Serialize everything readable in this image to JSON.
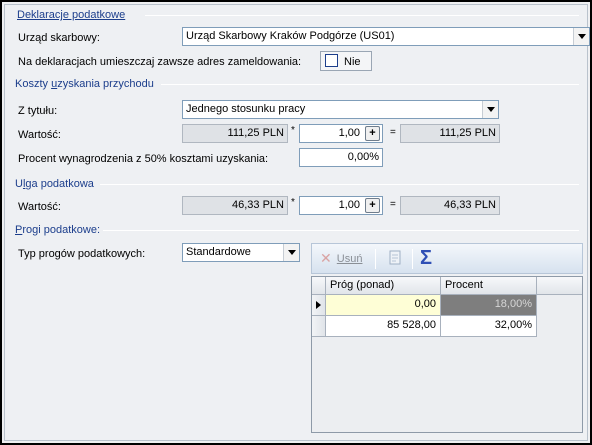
{
  "sections": {
    "declarations": "Deklaracje podatkowe",
    "costs_prefix": "Koszty ",
    "costs_u": "u",
    "costs_suffix": "zyskania przychodu",
    "relief_prefix": "U",
    "relief_u": "l",
    "relief_suffix": "ga podatkowa",
    "thresholds_prefix": "",
    "thresholds_u": "P",
    "thresholds_suffix": "rogi podatkowe:"
  },
  "declarations": {
    "tax_office_label": "Urząd skarbowy:",
    "tax_office_value": "Urząd Skarbowy Kraków Podgórze (US01)",
    "address_label": "Na deklaracjach umieszczaj zawsze adres zameldowania:",
    "address_checkbox_label": "Nie"
  },
  "costs": {
    "title_label": "Z tytułu:",
    "title_value": "Jednego stosunku pracy",
    "value_label": "Wartość:",
    "base_value": "111,25 PLN",
    "multiply_op": "*",
    "multiplier": "1,00",
    "equals_op": "=",
    "result": "111,25 PLN",
    "spin_symbol": "+",
    "percent_label": "Procent wynagrodzenia z 50% kosztami uzyskania:",
    "percent_value": "0,00%"
  },
  "relief": {
    "value_label": "Wartość:",
    "base_value": "46,33 PLN",
    "multiply_op": "*",
    "multiplier": "1,00",
    "equals_op": "=",
    "result": "46,33 PLN",
    "spin_symbol": "+"
  },
  "thresholds": {
    "type_label": "Typ progów podatkowych:",
    "type_value": "Standardowe",
    "toolbar": {
      "delete_label": "Usuń",
      "sum_symbol": "Σ"
    },
    "grid": {
      "columns": [
        "Próg (ponad)",
        "Procent"
      ],
      "rows": [
        [
          "0,00",
          "18,00%"
        ],
        [
          "85 528,00",
          "32,00%"
        ]
      ]
    }
  }
}
